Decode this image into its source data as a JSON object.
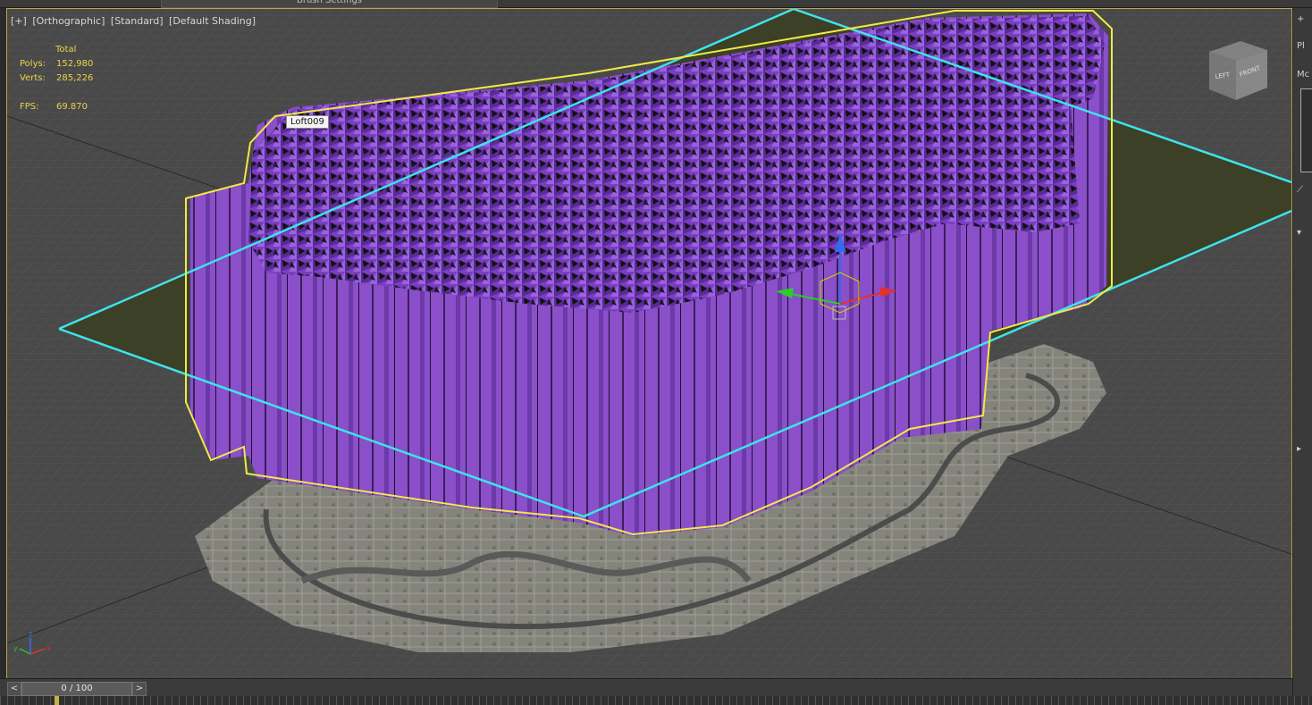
{
  "topbar": {
    "tab_label": "Brush Settings"
  },
  "viewport": {
    "label_plus": "[+]",
    "label_projection": "[Orthographic]",
    "label_standard": "[Standard]",
    "label_shading": "[Default Shading]",
    "stats": {
      "header": "Total",
      "polys_label": "Polys:",
      "polys_value": "152,980",
      "verts_label": "Verts:",
      "verts_value": "285,226",
      "fps_label": "FPS:",
      "fps_value": "69.870"
    },
    "object_tag": "Loft009",
    "viewcube": {
      "left": "LEFT",
      "front": "FRONT"
    },
    "axes": {
      "x": "x",
      "y": "y",
      "z": "z"
    }
  },
  "right_panel": {
    "item1": "Pl",
    "item2": "Mc"
  },
  "timeline": {
    "prev_label": "<",
    "next_label": ">",
    "frame_text": "0 / 100"
  },
  "colors": {
    "mesh": "#8a4fc9",
    "selection_bracket": "#f2e84a",
    "plane_outline": "#3fe3ea",
    "ground": "#3b4026",
    "viewport_bg": "#494949"
  }
}
